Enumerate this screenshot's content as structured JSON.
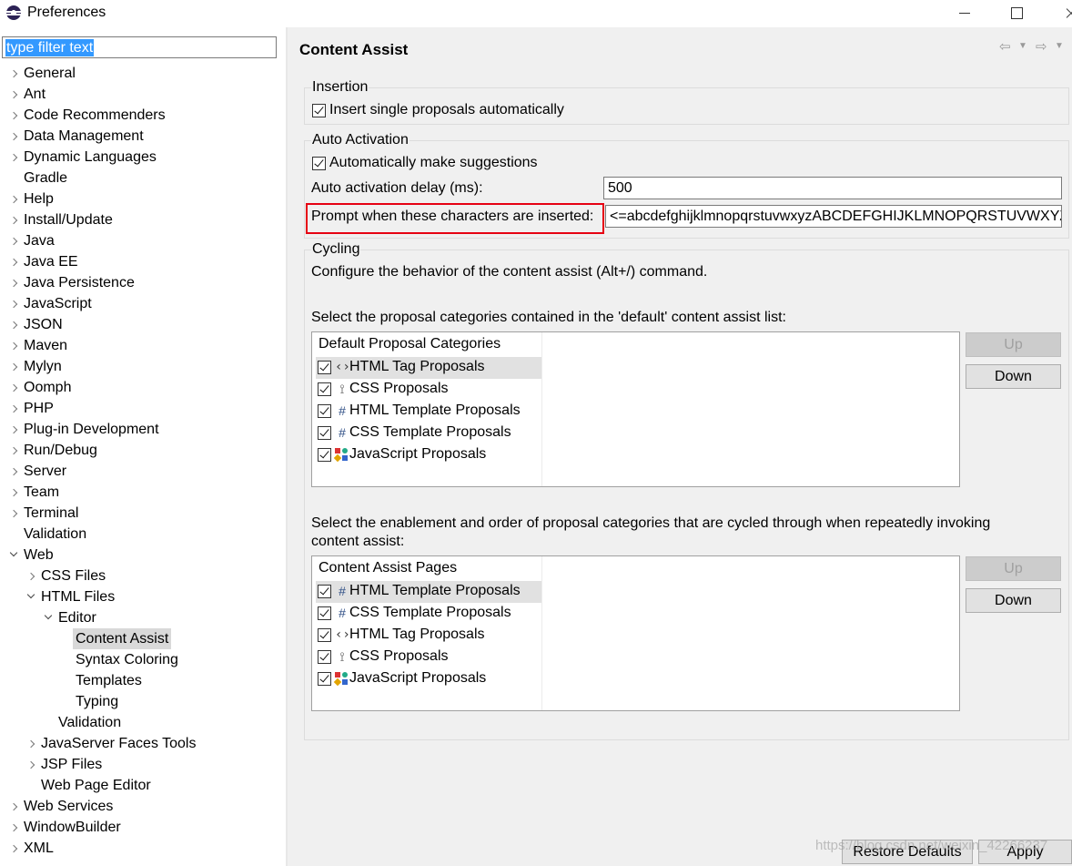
{
  "window": {
    "title": "Preferences"
  },
  "left": {
    "filter_text": "type filter text",
    "tree": [
      {
        "label": "General",
        "arrow": "collapsed",
        "level": 0
      },
      {
        "label": "Ant",
        "arrow": "collapsed",
        "level": 0
      },
      {
        "label": "Code Recommenders",
        "arrow": "collapsed",
        "level": 0
      },
      {
        "label": "Data Management",
        "arrow": "collapsed",
        "level": 0
      },
      {
        "label": "Dynamic Languages",
        "arrow": "collapsed",
        "level": 0
      },
      {
        "label": "Gradle",
        "arrow": "none",
        "level": 0
      },
      {
        "label": "Help",
        "arrow": "collapsed",
        "level": 0
      },
      {
        "label": "Install/Update",
        "arrow": "collapsed",
        "level": 0
      },
      {
        "label": "Java",
        "arrow": "collapsed",
        "level": 0
      },
      {
        "label": "Java EE",
        "arrow": "collapsed",
        "level": 0
      },
      {
        "label": "Java Persistence",
        "arrow": "collapsed",
        "level": 0
      },
      {
        "label": "JavaScript",
        "arrow": "collapsed",
        "level": 0
      },
      {
        "label": "JSON",
        "arrow": "collapsed",
        "level": 0
      },
      {
        "label": "Maven",
        "arrow": "collapsed",
        "level": 0
      },
      {
        "label": "Mylyn",
        "arrow": "collapsed",
        "level": 0
      },
      {
        "label": "Oomph",
        "arrow": "collapsed",
        "level": 0
      },
      {
        "label": "PHP",
        "arrow": "collapsed",
        "level": 0
      },
      {
        "label": "Plug-in Development",
        "arrow": "collapsed",
        "level": 0
      },
      {
        "label": "Run/Debug",
        "arrow": "collapsed",
        "level": 0
      },
      {
        "label": "Server",
        "arrow": "collapsed",
        "level": 0
      },
      {
        "label": "Team",
        "arrow": "collapsed",
        "level": 0
      },
      {
        "label": "Terminal",
        "arrow": "collapsed",
        "level": 0
      },
      {
        "label": "Validation",
        "arrow": "none",
        "level": 0
      },
      {
        "label": "Web",
        "arrow": "expanded",
        "level": 0
      },
      {
        "label": "CSS Files",
        "arrow": "collapsed",
        "level": 1
      },
      {
        "label": "HTML Files",
        "arrow": "expanded",
        "level": 1
      },
      {
        "label": "Editor",
        "arrow": "expanded",
        "level": 2
      },
      {
        "label": "Content Assist",
        "arrow": "none",
        "level": 3,
        "selected": true
      },
      {
        "label": "Syntax Coloring",
        "arrow": "none",
        "level": 3
      },
      {
        "label": "Templates",
        "arrow": "none",
        "level": 3
      },
      {
        "label": "Typing",
        "arrow": "none",
        "level": 3
      },
      {
        "label": "Validation",
        "arrow": "none",
        "level": 2
      },
      {
        "label": "JavaServer Faces Tools",
        "arrow": "collapsed",
        "level": 1
      },
      {
        "label": "JSP Files",
        "arrow": "collapsed",
        "level": 1
      },
      {
        "label": "Web Page Editor",
        "arrow": "none",
        "level": 1
      },
      {
        "label": "Web Services",
        "arrow": "collapsed",
        "level": 0
      },
      {
        "label": "WindowBuilder",
        "arrow": "collapsed",
        "level": 0
      },
      {
        "label": "XML",
        "arrow": "collapsed",
        "level": 0
      }
    ]
  },
  "page": {
    "title": "Content Assist",
    "insertion": {
      "title": "Insertion",
      "single_proposals": "Insert single proposals automatically"
    },
    "auto_activation": {
      "title": "Auto Activation",
      "make_suggestions": "Automatically make suggestions",
      "delay_label": "Auto activation delay (ms):",
      "delay_value": "500",
      "prompt_label": "Prompt when these characters are inserted:",
      "prompt_value": "<=abcdefghijklmnopqrstuvwxyzABCDEFGHIJKLMNOPQRSTUVWXYZ"
    },
    "cycling": {
      "title": "Cycling",
      "description": "Configure the behavior of the content assist (Alt+/) command.",
      "default_list_label": "Select the proposal categories contained in the 'default' content assist list:",
      "default_header": "Default Proposal Categories",
      "default_items": [
        {
          "label": "HTML Tag Proposals",
          "icon": "tag-icon",
          "selected": true
        },
        {
          "label": "CSS Proposals",
          "icon": "css-icon"
        },
        {
          "label": "HTML Template Proposals",
          "icon": "template-icon"
        },
        {
          "label": "CSS Template Proposals",
          "icon": "template-icon"
        },
        {
          "label": "JavaScript Proposals",
          "icon": "javascript-icon"
        }
      ],
      "cycled_label_line1": "Select the enablement and order of proposal categories that are cycled through when repeatedly invoking",
      "cycled_label_line2": "content assist:",
      "cycled_header": "Content Assist Pages",
      "cycled_items": [
        {
          "label": "HTML Template Proposals",
          "icon": "template-icon",
          "selected": true
        },
        {
          "label": "CSS Template Proposals",
          "icon": "template-icon"
        },
        {
          "label": "HTML Tag Proposals",
          "icon": "tag-icon"
        },
        {
          "label": "CSS Proposals",
          "icon": "css-icon"
        },
        {
          "label": "JavaScript Proposals",
          "icon": "javascript-icon"
        }
      ],
      "up": "Up",
      "down": "Down"
    },
    "restore_defaults": "Restore Defaults",
    "apply": "Apply"
  },
  "watermark": "https://blog.csdn.net/weixin_42266237",
  "colors": {
    "highlight_border": "#e60012",
    "selection": "#3399ff"
  }
}
